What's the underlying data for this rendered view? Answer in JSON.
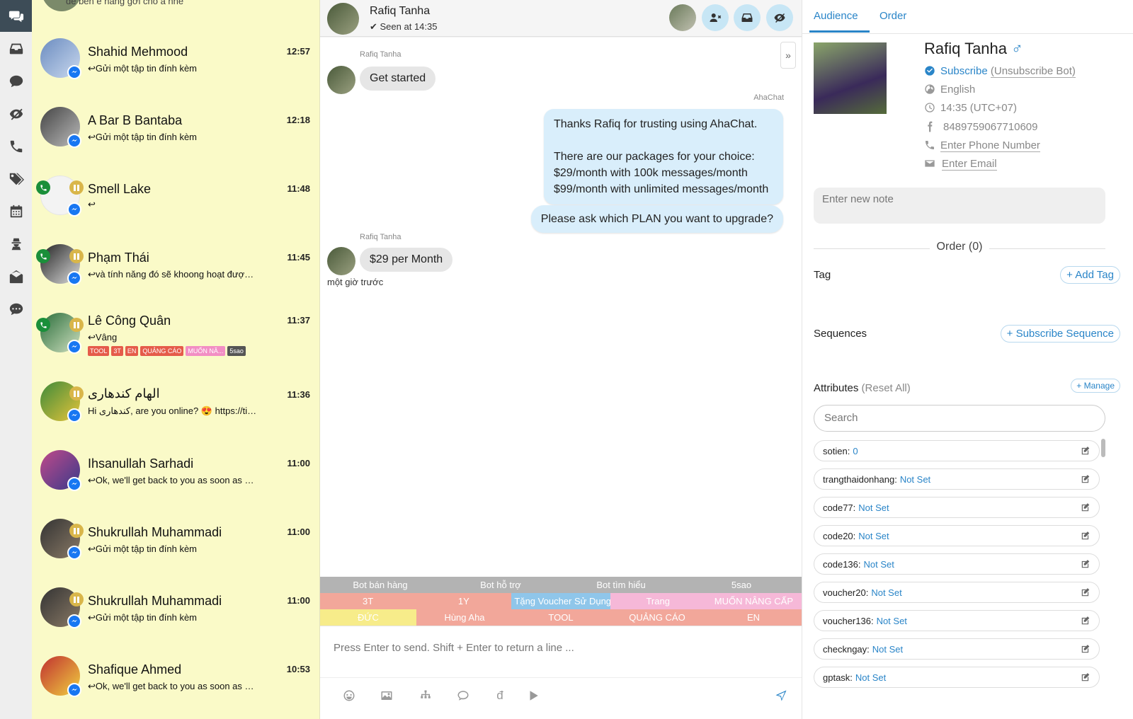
{
  "conversation_list": {
    "top_partial_preview": "đề bên e hàng gởi cho a nhé",
    "items": [
      {
        "name": "Shahid Mehmood",
        "time": "12:57",
        "preview": "Gửi một tập tin đính kèm"
      },
      {
        "name": "A Bar B Bantaba",
        "time": "12:18",
        "preview": "Gửi một tập tin đính kèm"
      },
      {
        "name": "Smell Lake",
        "time": "11:48",
        "preview": ""
      },
      {
        "name": "Phạm Thái",
        "time": "11:45",
        "preview": "và tính năng đó sẽ khoong hoạt được bạn ơi"
      },
      {
        "name": "Lê Công Quân",
        "time": "11:37",
        "preview": "Vâng",
        "tags": [
          "TOOL",
          "3T",
          "EN",
          "QUẢNG CÁO",
          "MUỐN NÂ...",
          "5sao"
        ]
      },
      {
        "name": "الهام کندهاری",
        "time": "11:36",
        "preview": "Hi کندهاری, are you online? 😍 https://tinyurl.com"
      },
      {
        "name": "Ihsanullah Sarhadi",
        "time": "11:00",
        "preview": "Ok, we'll get back to you as soon as possible."
      },
      {
        "name": "Shukrullah Muhammadi",
        "time": "11:00",
        "preview": "Gửi một tập tin đính kèm"
      },
      {
        "name": "Shukrullah Muhammadi",
        "time": "11:00",
        "preview": "Gửi một tập tin đính kèm"
      },
      {
        "name": "Shafique Ahmed",
        "time": "10:53",
        "preview": "Ok, we'll get back to you as soon as possible."
      }
    ]
  },
  "chat": {
    "header": {
      "name": "Rafiq Tanha",
      "seen": "Seen at 14:35"
    },
    "messages": {
      "m1_sender": "Rafiq Tanha",
      "m1_text": "Get started",
      "m2_sender": "AhaChat",
      "m2_line1": "Thanks Rafiq for trusting using AhaChat.",
      "m2_line2": "There are our packages for your choice:",
      "m2_line3": "$29/month with 100k messages/month",
      "m2_line4": "$99/month with unlimited messages/month",
      "m3_text": "Please ask which PLAN you want to upgrade?",
      "m4_sender": "Rafiq Tanha",
      "m4_text": "$29 per Month",
      "m4_time": "một giờ trước"
    },
    "quick_replies": {
      "row1": [
        "Bot bán hàng",
        "Bot hỗ trợ",
        "Bot tìm hiểu",
        "5sao"
      ],
      "row2": [
        "3T",
        "1Y",
        "Tặng Voucher Sử Dụng",
        "Trang",
        "MUỐN NÂNG CẤP"
      ],
      "row3": [
        "ĐỨC",
        "Hùng Aha",
        "TOOL",
        "QUẢNG CÁO",
        "EN"
      ]
    },
    "input_placeholder": "Press Enter to send. Shift + Enter to return a line ..."
  },
  "right_panel": {
    "tabs": [
      "Audience",
      "Order"
    ],
    "profile": {
      "name": "Rafiq Tanha",
      "gender_symbol": "♂",
      "subscribe": "Subscribe",
      "unsubscribe": "(Unsubscribe Bot)",
      "language": "English",
      "timezone": "14:35 (UTC+07)",
      "facebook_id": "8489759067710609",
      "phone_placeholder": "Enter Phone Number",
      "email_placeholder": "Enter Email"
    },
    "note_placeholder": "Enter new note",
    "order_label": "Order (0)",
    "tag_label": "Tag",
    "add_tag": "+ Add Tag",
    "sequences_label": "Sequences",
    "subscribe_sequence": "+ Subscribe Sequence",
    "attributes_label": "Attributes",
    "reset_all": "(Reset All)",
    "manage": "+ Manage",
    "search_placeholder": "Search",
    "attributes": [
      {
        "key": "sotien:",
        "value": "0"
      },
      {
        "key": "trangthaidonhang:",
        "value": "Not Set"
      },
      {
        "key": "code77:",
        "value": "Not Set"
      },
      {
        "key": "code20:",
        "value": "Not Set"
      },
      {
        "key": "code136:",
        "value": "Not Set"
      },
      {
        "key": "voucher20:",
        "value": "Not Set"
      },
      {
        "key": "voucher136:",
        "value": "Not Set"
      },
      {
        "key": "checkngay:",
        "value": "Not Set"
      },
      {
        "key": "gptask:",
        "value": "Not Set"
      }
    ]
  },
  "colors": {
    "accent": "#2a85c8",
    "list_bg": "#fafac8",
    "rail_active": "#3d4c57",
    "bubble_out": "#d9eefb"
  }
}
